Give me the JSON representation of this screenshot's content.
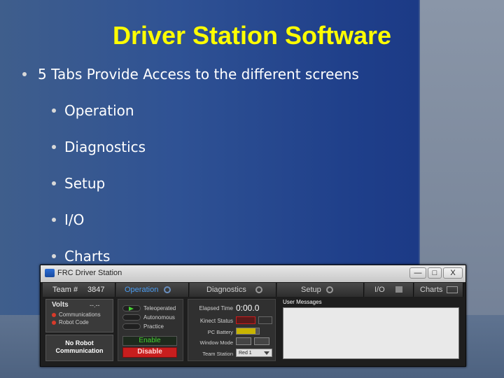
{
  "slide": {
    "title": "Driver Station Software",
    "main_bullet": "5 Tabs Provide Access to the different screens",
    "sub_bullets": [
      "Operation",
      "Diagnostics",
      "Setup",
      "I/O",
      "Charts"
    ]
  },
  "window": {
    "title": "FRC Driver Station",
    "controls": {
      "minimize": "—",
      "maximize": "□",
      "close": "X"
    }
  },
  "tabs": {
    "team_label": "Team #",
    "team_number": "3847",
    "operation": "Operation",
    "diagnostics": "Diagnostics",
    "setup": "Setup",
    "io": "I/O",
    "charts": "Charts"
  },
  "status": {
    "volts_label": "Volts",
    "volts_value": "--.--",
    "communications": "Communications",
    "robot_code": "Robot Code",
    "no_robot_line1": "No Robot",
    "no_robot_line2": "Communication"
  },
  "modes": [
    "Teleoperated",
    "Autonomous",
    "Practice"
  ],
  "actions": {
    "enable": "Enable",
    "disable": "Disable"
  },
  "fields": {
    "elapsed_time_label": "Elapsed Time",
    "elapsed_time_value": "0:00.0",
    "kinect_status_label": "Kinect Status",
    "pc_battery_label": "PC Battery",
    "window_mode_label": "Window Mode",
    "team_station_label": "Team Station",
    "team_station_value": "Red 1"
  },
  "messages": {
    "label": "User Messages"
  },
  "colors": {
    "title": "#ffff00",
    "led": "#d93a2a",
    "active_mode": "#46d232",
    "disable": "#c81e1e"
  }
}
